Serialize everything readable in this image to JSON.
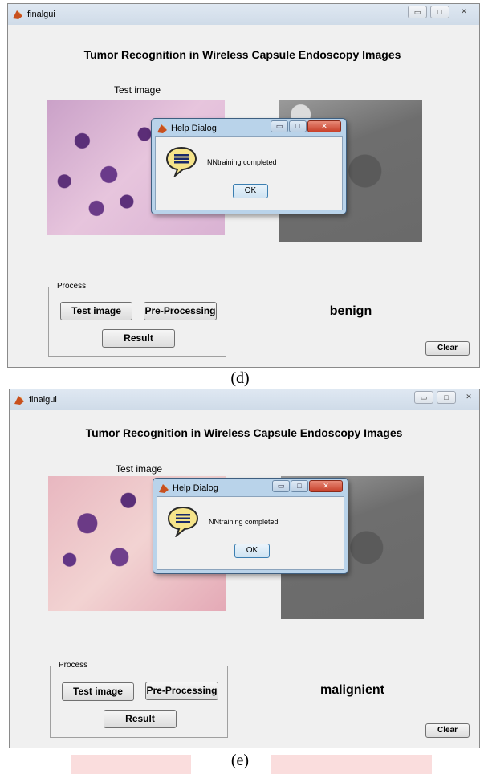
{
  "panels": [
    {
      "window_title": "finalgui",
      "heading": "Tumor Recognition in Wireless Capsule Endoscopy Images",
      "test_image_label": "Test image",
      "dialog": {
        "title": "Help Dialog",
        "message": "NNtraining completed",
        "ok_label": "OK"
      },
      "process_legend": "Process",
      "buttons": {
        "test_image": "Test image",
        "pre_processing": "Pre-Processing",
        "result": "Result",
        "clear": "Clear"
      },
      "result_text": "benign",
      "caption": "(d)"
    },
    {
      "window_title": "finalgui",
      "heading": "Tumor Recognition in Wireless Capsule Endoscopy Images",
      "test_image_label": "Test image",
      "dialog": {
        "title": "Help Dialog",
        "message": "NNtraining completed",
        "ok_label": "OK"
      },
      "process_legend": "Process",
      "buttons": {
        "test_image": "Test image",
        "pre_processing": "Pre-Processing",
        "result": "Result",
        "clear": "Clear"
      },
      "result_text": "malignient",
      "caption": "(e)"
    }
  ],
  "window_controls": {
    "minimize": "▭",
    "maximize": "□",
    "close": "✕"
  },
  "icons": {
    "app": "matlab-icon",
    "help": "help-speech-bubble-icon"
  },
  "colors": {
    "window_bg": "#f0f0f0",
    "titlebar": "#cfdbe8",
    "dialog_frame": "#b9d3ea",
    "close_red": "#c8402a"
  }
}
